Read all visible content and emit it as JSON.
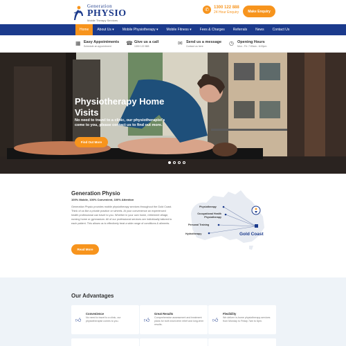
{
  "header": {
    "logo_line1": "Generation",
    "logo_line2": "PHYSIO",
    "logo_line3": "Mobile Therapy Services",
    "phone_number": "1300 122 888",
    "phone_sub": "24 Hour Enquiry",
    "enquiry_button": "Make Enquiry"
  },
  "nav": {
    "items": [
      {
        "label": "Home"
      },
      {
        "label": "About Us ▾"
      },
      {
        "label": "Mobile Physiotherapy ▾"
      },
      {
        "label": "Mobile Fitness ▾"
      },
      {
        "label": "Fees & Charges"
      },
      {
        "label": "Referrals"
      },
      {
        "label": "News"
      },
      {
        "label": "Contact Us"
      }
    ],
    "active_color": "#f7941d",
    "bar_color": "#1b3a8c"
  },
  "infobar": {
    "items": [
      {
        "title": "Easy Appointments",
        "sub": "Schedule an appointment",
        "icon": "calendar-icon"
      },
      {
        "title": "Give us a call",
        "sub": "1300 122 888",
        "icon": "phone-icon"
      },
      {
        "title": "Send us a message",
        "sub": "Contact us here",
        "icon": "envelope-icon"
      },
      {
        "title": "Opening Hours",
        "sub": "Mon - Fri: 7:00am - 6:00pm",
        "icon": "clock-icon"
      }
    ]
  },
  "hero": {
    "title": "Physiotherapy Home Visits",
    "text": "No need to travel to a clinic, our physiotherapist's come to you, please contact us to find out more.",
    "button": "Find Out More",
    "slides": 4,
    "active_slide": 1
  },
  "about": {
    "title": "Generation Physio",
    "subtitle": "100% Mobile, 100% Convenient, 100% Attention",
    "body": "Generation Physio provides mobile physiotherapy services throughout the Gold Coast. Think of us like a private practice on wheels. At your convenience an experienced health professional can travel to you. Whether in your own home, retirement village, nursing home or gymnasium. All of our professional services are individually tailored to each patient. This allows us to effectively treat a wide range of conditions & ailments.",
    "button": "Read More",
    "map": {
      "labels": [
        "Physiotherapy",
        "Occupational Health Physiotherapy",
        "Personal Training",
        "Hydrotherapy"
      ],
      "location": "Gold Coast"
    }
  },
  "advantages": {
    "title": "Our Advantages",
    "cards": [
      {
        "title": "Convenience",
        "text": "No need to travel to a clinic, our physiotherapist comes to you.",
        "icon": "thumbs-up-icon"
      },
      {
        "title": "Great Results",
        "text": "Comprehensive assessment and treatment plans for both short-term relief and long-term results.",
        "icon": "thumbs-up-icon"
      },
      {
        "title": "Flexibility",
        "text": "We deliver in-home physiotherapy services from Monday to Friday 7am to 6pm.",
        "icon": "thumbs-up-icon"
      }
    ]
  }
}
